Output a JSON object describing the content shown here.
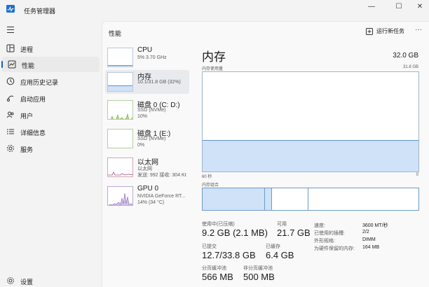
{
  "window": {
    "title": "任务管理器"
  },
  "controls": {
    "minimize": "—",
    "maximize": "☐",
    "close": "✕"
  },
  "nav": {
    "items": [
      {
        "label": "进程",
        "icon": "processes-icon"
      },
      {
        "label": "性能",
        "icon": "performance-icon",
        "active": true
      },
      {
        "label": "应用历史记录",
        "icon": "app-history-icon"
      },
      {
        "label": "启动应用",
        "icon": "startup-icon"
      },
      {
        "label": "用户",
        "icon": "users-icon"
      },
      {
        "label": "详细信息",
        "icon": "details-icon"
      },
      {
        "label": "服务",
        "icon": "services-icon"
      }
    ],
    "settings": "设置"
  },
  "header": {
    "title": "性能",
    "run_task": "运行新任务",
    "more": "···"
  },
  "devices": [
    {
      "name": "CPU",
      "sub1": "5%  3.70 GHz",
      "sub2": "",
      "usage": 0.05
    },
    {
      "name": "内存",
      "sub1": "10.1/31.8 GB (32%)",
      "sub2": "",
      "usage": 0.32
    },
    {
      "name": "磁盘 0 (C: D:)",
      "sub1": "SSD (NVMe)",
      "sub2": "10%",
      "usage": 0.1
    },
    {
      "name": "磁盘 1 (E:)",
      "sub1": "SSD (NVMe)",
      "sub2": "0%",
      "usage": 0.0
    },
    {
      "name": "以太网",
      "sub1": "以太网",
      "sub2": "发送: 992 接收: 304 Kt",
      "usage": 0.1
    },
    {
      "name": "GPU 0",
      "sub1": "NVIDIA GeForce RT...",
      "sub2": "14% (34 °C)",
      "usage": 0.14
    }
  ],
  "detail": {
    "title": "内存",
    "total": "32.0 GB",
    "usage_label": "内存使用量",
    "usage_max": "31.8 GB",
    "axis_left": "60 秒",
    "axis_right": "0",
    "composition_label": "内存组合",
    "usage_fraction": 0.32,
    "composition": [
      0.29,
      0.03,
      0.17,
      0.51
    ]
  },
  "stats": {
    "in_use_label": "使用中(已压缩)",
    "in_use_value": "9.2 GB (2.1 MB)",
    "available_label": "可用",
    "available_value": "21.7 GB",
    "committed_label": "已提交",
    "committed_value": "12.7/33.8 GB",
    "cached_label": "已缓存",
    "cached_value": "6.4 GB",
    "paged_label": "分页缓冲池",
    "paged_value": "566 MB",
    "nonpaged_label": "非分页缓冲池",
    "nonpaged_value": "500 MB"
  },
  "specs": [
    {
      "key": "速度:",
      "value": "3600 MT/秒"
    },
    {
      "key": "已使用的插槽:",
      "value": "2/2"
    },
    {
      "key": "外形规格:",
      "value": "DIMM"
    },
    {
      "key": "为硬件保留的内存:",
      "value": "164 MB"
    }
  ],
  "colors": {
    "accent": "#0067c0",
    "memory_fill": "#cfe2f8",
    "memory_line": "#5e94c8"
  }
}
